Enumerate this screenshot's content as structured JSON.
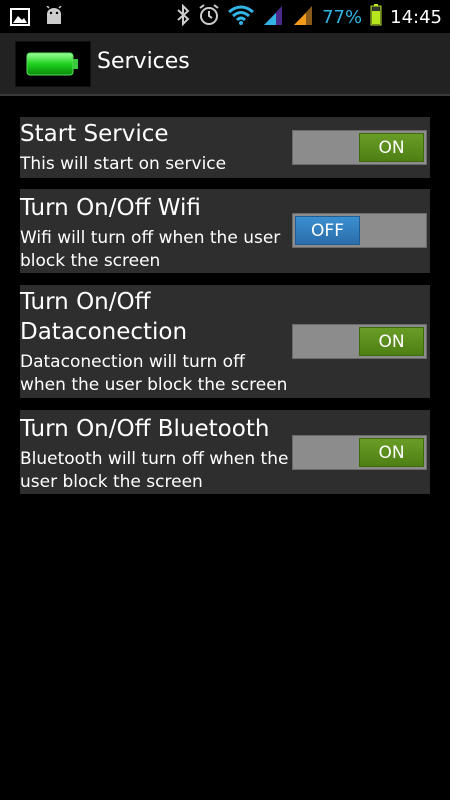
{
  "status_bar": {
    "battery_percent": "77%",
    "time": "14:45",
    "icons": [
      "image-icon",
      "android-debug-icon",
      "bluetooth-icon",
      "alarm-icon",
      "wifi-icon",
      "signal-icon",
      "signal-icon",
      "battery-icon"
    ]
  },
  "action_bar": {
    "title": "Services",
    "icon": "battery-full-icon"
  },
  "settings": [
    {
      "title": "Start Service",
      "summary": "This will start on service",
      "toggle": "ON"
    },
    {
      "title": "Turn On/Off Wifi",
      "summary": "Wifi will turn off when the user block the screen",
      "toggle": "OFF"
    },
    {
      "title": "Turn On/Off Dataconection",
      "summary": "Dataconection will turn off when the user block the screen",
      "toggle": "ON"
    },
    {
      "title": "Turn On/Off Bluetooth",
      "summary": "Bluetooth will turn off when the user block the screen",
      "toggle": "ON"
    }
  ],
  "colors": {
    "on_toggle": "#5a8f1c",
    "off_toggle": "#3383c4",
    "card_bg": "#2e2e2e",
    "accent": "#32b4e5"
  }
}
